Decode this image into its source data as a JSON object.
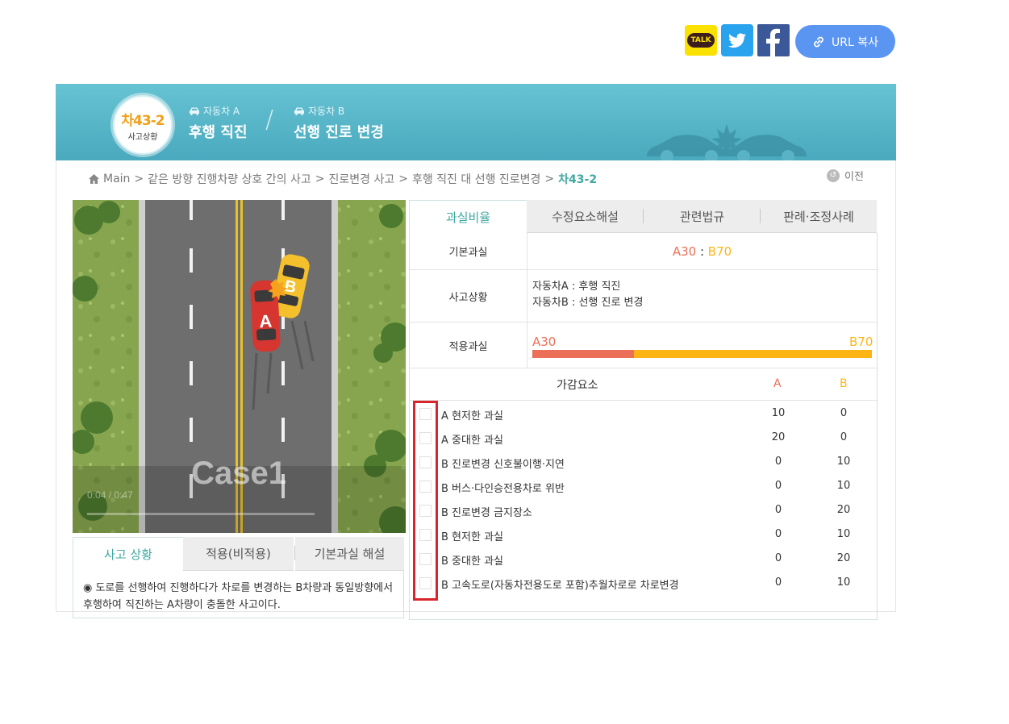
{
  "share": {
    "talk_label": "TALK",
    "twitter_icon": "twitter-bird-icon",
    "facebook_icon": "facebook-f-icon",
    "url_copy_label": "URL 복사"
  },
  "header": {
    "case_code": "차43-2",
    "case_sub": "사고상황",
    "vehicle_a_label": "자동차 A",
    "vehicle_a_action": "후행 직진",
    "vehicle_b_label": "자동차 B",
    "vehicle_b_action": "선행 진로 변경"
  },
  "breadcrumb": {
    "items": [
      "Main",
      "같은 방향 진행차량 상호 간의 사고",
      "진로변경 사고",
      "후행 직진 대 선행 진로변경"
    ],
    "current": "차43-2",
    "separator": ">",
    "prev_label": "이전"
  },
  "video": {
    "overlay_text": "Case1",
    "time_text": "0:04 / 0:47",
    "car_a_label": "A",
    "car_b_label": "B"
  },
  "left_tabs": {
    "items": [
      "사고 상황",
      "적용(비적용)",
      "기본과실 해설"
    ],
    "active": 0,
    "description": "◉ 도로를 선행하여 진행하다가 차로를 변경하는 B차량과 동일방향에서 후행하여 직진하는 A차량이 충돌한 사고이다."
  },
  "right_tabs": {
    "items": [
      "과실비율",
      "수정요소해설",
      "관련법규",
      "판례·조정사례"
    ],
    "active": 0
  },
  "ratio": {
    "basic_label": "기본과실",
    "basic_a": "A30",
    "basic_sep": " : ",
    "basic_b": "B70",
    "situation_label": "사고상황",
    "situation_a": "자동차A : 후행 직진",
    "situation_b": "자동차B : 선행 진로 변경",
    "applied_label": "적용과실",
    "applied_a": "A30",
    "applied_b": "B70",
    "a_percent": 30,
    "color_a": "#ec6f58",
    "color_b": "#fdb515"
  },
  "factors": {
    "header": "가감요소",
    "col_a": "A",
    "col_b": "B",
    "rows": [
      {
        "label": "A 현저한 과실",
        "a": "10",
        "b": "0"
      },
      {
        "label": "A 중대한 과실",
        "a": "20",
        "b": "0"
      },
      {
        "label": "B 진로변경 신호불이행·지연",
        "a": "0",
        "b": "10"
      },
      {
        "label": "B 버스·다인승전용차로 위반",
        "a": "0",
        "b": "10"
      },
      {
        "label": "B 진로변경 금지장소",
        "a": "0",
        "b": "20"
      },
      {
        "label": "B 현저한 과실",
        "a": "0",
        "b": "10"
      },
      {
        "label": "B 중대한 과실",
        "a": "0",
        "b": "20"
      },
      {
        "label": "B 고속도로(자동차전용도로 포함)추월차로로 차로변경",
        "a": "0",
        "b": "10"
      }
    ]
  }
}
